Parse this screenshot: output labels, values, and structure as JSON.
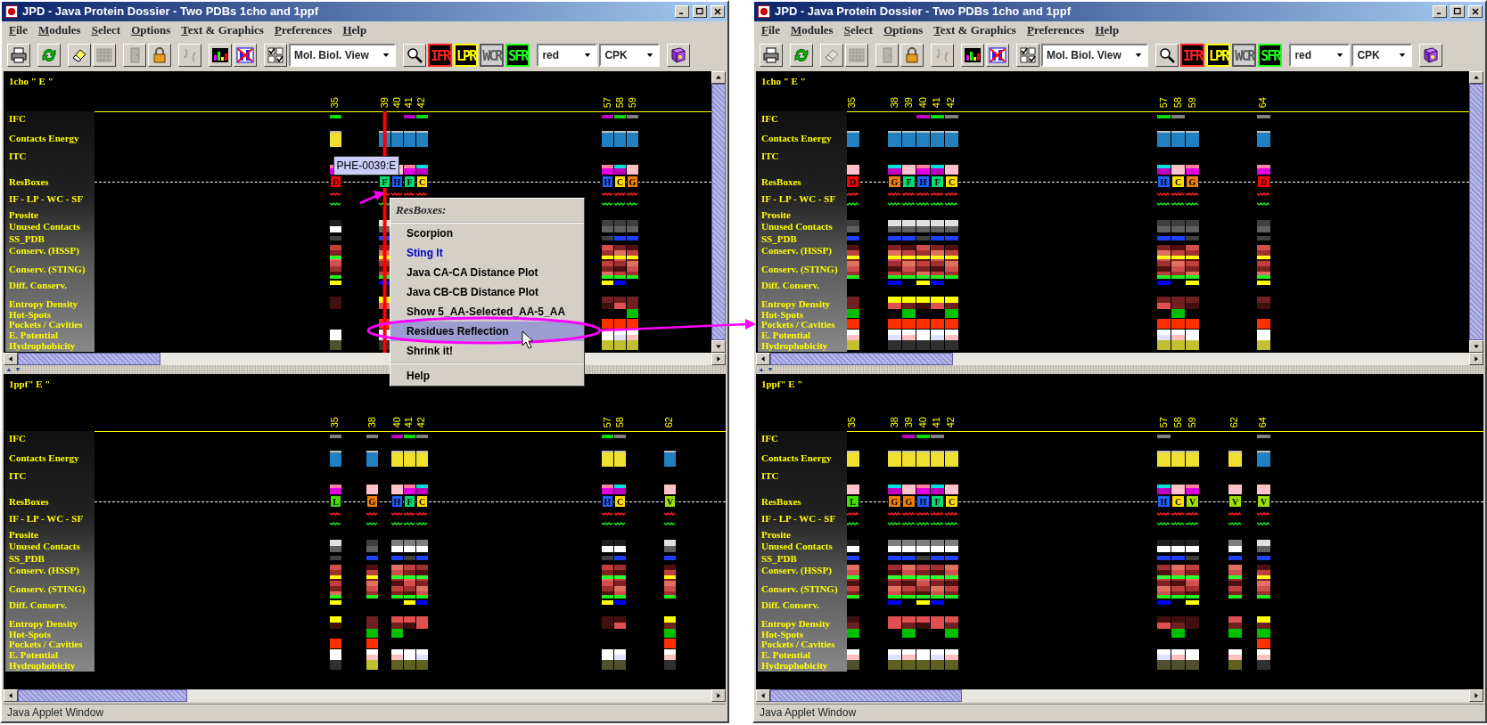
{
  "windows": [
    {
      "title": "JPD - Java Protein Dossier - Two PDBs 1cho and 1ppf",
      "menu": [
        "File",
        "Modules",
        "Select",
        "Options",
        "Text & Graphics",
        "Preferences",
        "Help"
      ],
      "toolbar": [
        [
          {
            "kind": "icon",
            "disabled": false
          }
        ],
        [
          {
            "kind": "icon",
            "disabled": false
          }
        ],
        [
          {
            "kind": "icon",
            "disabled": false
          },
          {
            "kind": "icon",
            "disabled": true
          }
        ],
        [
          {
            "kind": "icon",
            "disabled": true
          },
          {
            "kind": "icon",
            "disabled": false
          }
        ],
        [
          {
            "kind": "icon",
            "disabled": true
          }
        ],
        [
          {
            "kind": "icon",
            "disabled": false
          },
          {
            "kind": "icon",
            "disabled": false
          }
        ],
        [
          {
            "kind": "icon",
            "disabled": false
          },
          {
            "kind": "dropdown",
            "value": "Mol. Biol. View"
          }
        ],
        [
          {
            "kind": "icon",
            "disabled": false
          },
          {
            "kind": "text",
            "label": "IFR",
            "color": "#ff2020",
            "disabled": false
          },
          {
            "kind": "text",
            "label": "LPR",
            "color": "#ffff00",
            "disabled": false
          },
          {
            "kind": "text",
            "label": "WCR",
            "color": "#5a5a5a",
            "disabled": true
          },
          {
            "kind": "text",
            "label": "SFR",
            "color": "#20ff20",
            "disabled": false
          }
        ],
        [
          {
            "kind": "dropdown",
            "value": "red"
          },
          {
            "kind": "dropdown",
            "value": "CPK"
          }
        ],
        [
          {
            "kind": "icon",
            "disabled": false
          }
        ]
      ],
      "panels": [
        {
          "title": "1cho \" E \"",
          "tooltip": "PHE-0039:E",
          "track_labels": [
            "IFC",
            "Contacts Energy",
            "ITC",
            "ResBoxes",
            "IF - LP - WC - SF",
            "Prosite",
            "Unused Contacts",
            "SS_PDB",
            "Conserv. (HSSP)",
            "Conserv. (STING)",
            "Diff. Conserv.",
            "Entropy Density",
            "Hot-Spots",
            "Pockets / Cavities",
            "E. Potential",
            "Hydrophobicity"
          ],
          "residues": [
            {
              "number": "35",
              "letter": "D",
              "color": "#ff0000",
              "selected": false
            },
            {
              "number": "39",
              "letter": "F",
              "color": "#00e070",
              "selected": true
            },
            {
              "number": "40",
              "letter": "H",
              "color": "#2060ff",
              "selected": false
            },
            {
              "number": "41",
              "letter": "F",
              "color": "#00e070",
              "selected": false
            },
            {
              "number": "42",
              "letter": "C",
              "color": "#ffe000",
              "selected": false
            },
            {
              "number": "57",
              "letter": "H",
              "color": "#2060ff",
              "selected": false
            },
            {
              "number": "58",
              "letter": "C",
              "color": "#ffe000",
              "selected": false
            },
            {
              "number": "59",
              "letter": "G",
              "color": "#f08000",
              "selected": false
            }
          ]
        },
        {
          "title": "1ppf\" E \"",
          "track_labels": [
            "IFC",
            "Contacts Energy",
            "ITC",
            "ResBoxes",
            "IF - LP - WC - SF",
            "Prosite",
            "Unused Contacts",
            "SS_PDB",
            "Conserv. (HSSP)",
            "Conserv. (STING)",
            "Diff. Conserv.",
            "Entropy Density",
            "Hot-Spots",
            "Pockets / Cavities",
            "E. Potential",
            "Hydrophobicity"
          ],
          "residues": [
            {
              "number": "35",
              "letter": "L",
              "color": "#40e000",
              "selected": false
            },
            {
              "number": "38",
              "letter": "G",
              "color": "#f08000",
              "selected": false
            },
            {
              "number": "40",
              "letter": "H",
              "color": "#2060ff",
              "selected": false
            },
            {
              "number": "41",
              "letter": "F",
              "color": "#00e070",
              "selected": false
            },
            {
              "number": "42",
              "letter": "C",
              "color": "#ffe000",
              "selected": false
            },
            {
              "number": "57",
              "letter": "H",
              "color": "#2060ff",
              "selected": false
            },
            {
              "number": "58",
              "letter": "C",
              "color": "#ffe000",
              "selected": false
            },
            {
              "number": "62",
              "letter": "V",
              "color": "#a0e000",
              "selected": false
            }
          ]
        }
      ],
      "context_menu": {
        "title": "ResBoxes:",
        "groups": [
          [
            {
              "label": "Scorpion",
              "kind": "action",
              "selected": false
            },
            {
              "label": "Sting It",
              "kind": "link",
              "selected": false
            },
            {
              "label": "Java CA-CA Distance Plot",
              "kind": "action",
              "selected": false
            },
            {
              "label": "Java CB-CB Distance Plot",
              "kind": "action",
              "selected": false
            },
            {
              "label": "Show 5_AA-Selected_AA-5_AA",
              "kind": "action",
              "selected": false
            },
            {
              "label": "Residues Reflection",
              "kind": "action",
              "selected": true
            },
            {
              "label": "Shrink it!",
              "kind": "action",
              "selected": false
            }
          ],
          [
            {
              "label": "Help",
              "kind": "action",
              "selected": false
            }
          ]
        ]
      },
      "status": "Java Applet Window"
    },
    {
      "title": "JPD - Java Protein Dossier - Two PDBs 1cho and 1ppf",
      "menu": [
        "File",
        "Modules",
        "Select",
        "Options",
        "Text & Graphics",
        "Preferences",
        "Help"
      ],
      "toolbar": [
        [
          {
            "kind": "icon",
            "disabled": false
          }
        ],
        [
          {
            "kind": "icon",
            "disabled": false
          }
        ],
        [
          {
            "kind": "icon",
            "disabled": true
          },
          {
            "kind": "icon",
            "disabled": true
          }
        ],
        [
          {
            "kind": "icon",
            "disabled": true
          },
          {
            "kind": "icon",
            "disabled": false
          }
        ],
        [
          {
            "kind": "icon",
            "disabled": true
          }
        ],
        [
          {
            "kind": "icon",
            "disabled": false
          },
          {
            "kind": "icon",
            "disabled": false
          }
        ],
        [
          {
            "kind": "icon",
            "disabled": false
          },
          {
            "kind": "dropdown",
            "value": "Mol. Biol. View"
          }
        ],
        [
          {
            "kind": "icon",
            "disabled": false
          },
          {
            "kind": "text",
            "label": "IFR",
            "color": "#ff2020",
            "disabled": false
          },
          {
            "kind": "text",
            "label": "LPR",
            "color": "#ffff00",
            "disabled": false
          },
          {
            "kind": "text",
            "label": "WCR",
            "color": "#5a5a5a",
            "disabled": true
          },
          {
            "kind": "text",
            "label": "SFR",
            "color": "#20ff20",
            "disabled": false
          }
        ],
        [
          {
            "kind": "dropdown",
            "value": "red"
          },
          {
            "kind": "dropdown",
            "value": "CPK"
          }
        ],
        [
          {
            "kind": "icon",
            "disabled": false
          }
        ]
      ],
      "panels": [
        {
          "title": "1cho \" E \"",
          "track_labels": [
            "IFC",
            "Contacts Energy",
            "ITC",
            "ResBoxes",
            "IF - LP - WC - SF",
            "Prosite",
            "Unused Contacts",
            "SS_PDB",
            "Conserv. (HSSP)",
            "Conserv. (STING)",
            "Diff. Conserv.",
            "Entropy Density",
            "Hot-Spots",
            "Pockets / Cavities",
            "E. Potential",
            "Hydrophobicity"
          ],
          "residues": [
            {
              "number": "35",
              "letter": "D",
              "color": "#ff0000",
              "selected": false
            },
            {
              "number": "38",
              "letter": "G",
              "color": "#f08000",
              "selected": false
            },
            {
              "number": "39",
              "letter": "F",
              "color": "#00e070",
              "selected": false
            },
            {
              "number": "40",
              "letter": "H",
              "color": "#2060ff",
              "selected": false
            },
            {
              "number": "41",
              "letter": "F",
              "color": "#00e070",
              "selected": false
            },
            {
              "number": "42",
              "letter": "C",
              "color": "#ffe000",
              "selected": false
            },
            {
              "number": "57",
              "letter": "H",
              "color": "#2060ff",
              "selected": false
            },
            {
              "number": "58",
              "letter": "C",
              "color": "#ffe000",
              "selected": false
            },
            {
              "number": "59",
              "letter": "G",
              "color": "#f08000",
              "selected": false
            },
            {
              "number": "64",
              "letter": "D",
              "color": "#ff0000",
              "selected": false
            }
          ]
        },
        {
          "title": "1ppf\" E \"",
          "track_labels": [
            "IFC",
            "Contacts Energy",
            "ITC",
            "ResBoxes",
            "IF - LP - WC - SF",
            "Prosite",
            "Unused Contacts",
            "SS_PDB",
            "Conserv. (HSSP)",
            "Conserv. (STING)",
            "Diff. Conserv.",
            "Entropy Density",
            "Hot-Spots",
            "Pockets / Cavities",
            "E. Potential",
            "Hydrophobicity"
          ],
          "residues": [
            {
              "number": "35",
              "letter": "L",
              "color": "#40e000",
              "selected": false
            },
            {
              "number": "38",
              "letter": "G",
              "color": "#f08000",
              "selected": false
            },
            {
              "number": "39",
              "letter": "G",
              "color": "#f08000",
              "selected": false
            },
            {
              "number": "40",
              "letter": "H",
              "color": "#2060ff",
              "selected": false
            },
            {
              "number": "41",
              "letter": "F",
              "color": "#00e070",
              "selected": false
            },
            {
              "number": "42",
              "letter": "C",
              "color": "#ffe000",
              "selected": false
            },
            {
              "number": "57",
              "letter": "H",
              "color": "#2060ff",
              "selected": false
            },
            {
              "number": "58",
              "letter": "C",
              "color": "#ffe000",
              "selected": false
            },
            {
              "number": "59",
              "letter": "V",
              "color": "#a0e000",
              "selected": false
            },
            {
              "number": "62",
              "letter": "V",
              "color": "#a0e000",
              "selected": false
            },
            {
              "number": "64",
              "letter": "V",
              "color": "#a0e000",
              "selected": false
            }
          ]
        }
      ],
      "status": "Java Applet Window"
    }
  ]
}
